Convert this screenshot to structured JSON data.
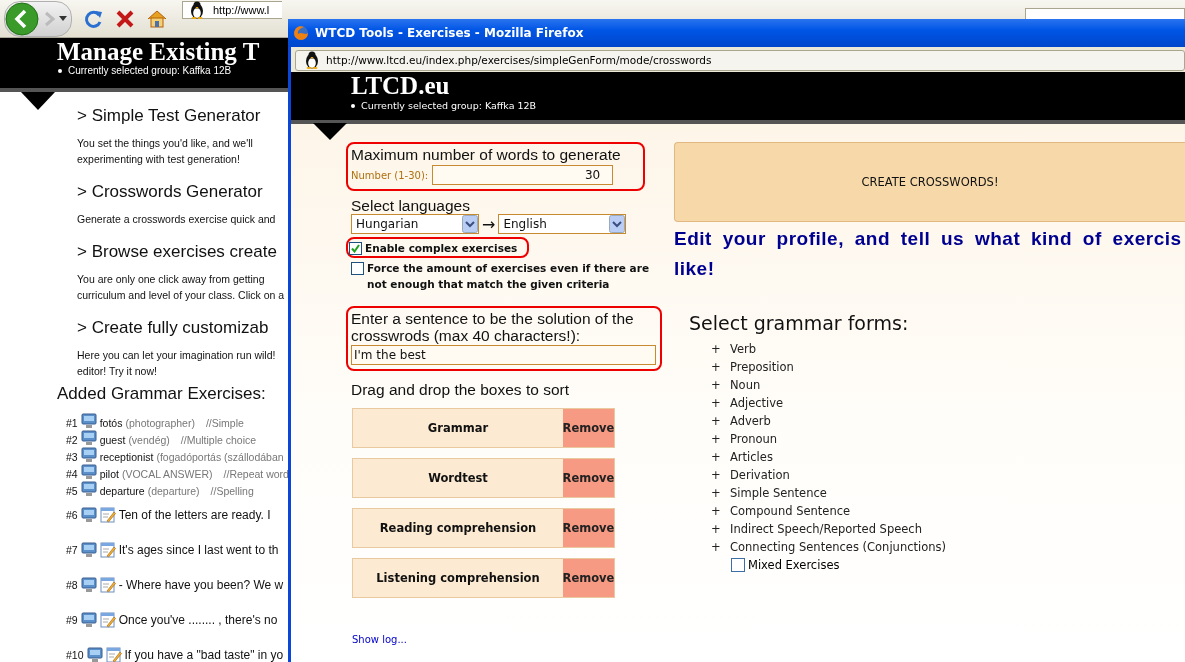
{
  "back_window": {
    "toolbar": {
      "address": "http://www.l"
    },
    "header": {
      "title": "Manage Existing T",
      "group": "Currently selected group: Kaffka 12B"
    },
    "sections": [
      {
        "heading": "> Simple Test Generator",
        "text": "You set the things you'd like, and we'll\nexperimenting with test generation!"
      },
      {
        "heading": "> Crosswords Generator",
        "text": "Generate a crosswords exercise quick and"
      },
      {
        "heading": "> Browse exercises create",
        "text": "You are only one click away from getting\ncurriculum and level of your class. Click on a"
      },
      {
        "heading": "> Create fully customizab",
        "text": "Here you can let your imagination run wild!\neditor! Try it now!"
      }
    ],
    "exercises_heading": "Added Grammar Exercises:",
    "exercises": [
      {
        "kind": "word",
        "number": "#1",
        "word": "fotós",
        "translation": "(photographer)",
        "type": "//Simple"
      },
      {
        "kind": "word",
        "number": "#2",
        "word": "guest",
        "translation": "(vendég)",
        "type": "//Multiple choice"
      },
      {
        "kind": "word",
        "number": "#3",
        "word": "receptionist",
        "translation": "(fogadóportás (szállodában"
      },
      {
        "kind": "word",
        "number": "#4",
        "word": "pilot",
        "translation": "(VOCAL ANSWER)",
        "type": "//Repeat word"
      },
      {
        "kind": "word",
        "number": "#5",
        "word": "departure",
        "translation": "(departure)",
        "type": "//Spelling"
      },
      {
        "kind": "sentence",
        "number": "#6",
        "text": "Ten of the letters are ready. I"
      },
      {
        "kind": "sentence",
        "number": "#7",
        "text": "It's ages since I last went to th"
      },
      {
        "kind": "sentence",
        "number": "#8",
        "text": "- Where have you been? We w"
      },
      {
        "kind": "sentence",
        "number": "#9",
        "text": "Once you've ........ , there's no"
      },
      {
        "kind": "sentence",
        "number": "#10",
        "text": "If you have a \"bad taste\" in yo"
      }
    ]
  },
  "popup": {
    "title": "WTCD Tools - Exercises - Mozilla Firefox",
    "address": "http://www.ltcd.eu/index.php/exercises/simpleGenForm/mode/crosswords",
    "header": {
      "title": "LTCD.eu",
      "group": "Currently selected group: Kaffka 12B"
    },
    "form": {
      "word_count": {
        "heading": "Maximum number of words to generate",
        "label": "Number (1-30):",
        "value": "30",
        "highlighted": true
      },
      "languages": {
        "heading": "Select languages",
        "from": "Hungarian",
        "arrow": "→",
        "to": "English"
      },
      "options": [
        {
          "label": "Enable complex exercises",
          "checked": true,
          "highlighted": true
        },
        {
          "label": "Force the amount of exercises even if there are not enough that match the given criteria",
          "checked": false,
          "highlighted": false
        }
      ],
      "solution": {
        "label": "Enter a sentence to be the solution of the crosswrods (max 40 characters!):",
        "value": "I'm the best",
        "highlighted": true
      },
      "sort_heading": "Drag and drop the boxes to sort",
      "sort_boxes": [
        {
          "label": "Grammar",
          "action": "Remove"
        },
        {
          "label": "Wordtest",
          "action": "Remove"
        },
        {
          "label": "Reading comprehension",
          "action": "Remove"
        },
        {
          "label": "Listening comprehension",
          "action": "Remove"
        }
      ],
      "show_log": "Show log..."
    },
    "create_button": "CREATE CROSSWORDS!",
    "profile_note": "Edit your profile, and tell us what kind of exercis\nlike!",
    "grammar": {
      "heading": "Select grammar forms:",
      "items": [
        {
          "expander": "+",
          "label": "Verb"
        },
        {
          "expander": "+",
          "label": "Preposition"
        },
        {
          "expander": "+",
          "label": "Noun"
        },
        {
          "expander": "+",
          "label": "Adjective"
        },
        {
          "expander": "+",
          "label": "Adverb"
        },
        {
          "expander": "+",
          "label": "Pronoun"
        },
        {
          "expander": "+",
          "label": "Articles"
        },
        {
          "expander": "+",
          "label": "Derivation"
        },
        {
          "expander": "+",
          "label": "Simple Sentence"
        },
        {
          "expander": "+",
          "label": "Compound Sentence"
        },
        {
          "expander": "+",
          "label": "Indirect Speech/Reported Speech"
        },
        {
          "expander": "+",
          "label": "Connecting Sentences (Conjunctions)"
        }
      ],
      "mixed": {
        "label": "Mixed Exercises",
        "checked": false
      }
    }
  }
}
